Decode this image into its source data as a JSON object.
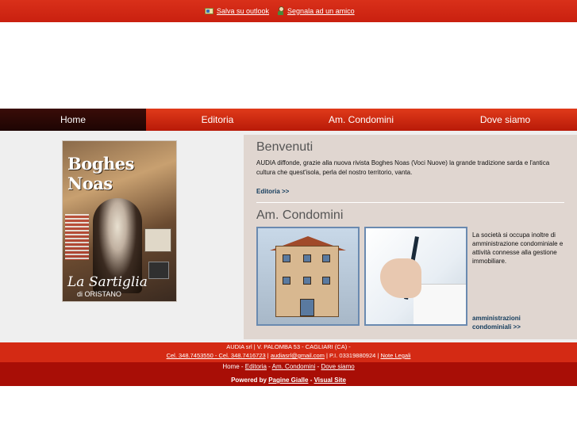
{
  "topbar": {
    "outlook_label": "Salva su outlook",
    "outlook_icon": "outlook-icon",
    "friend_label": "Segnala ad un amico",
    "friend_icon": "person-icon"
  },
  "nav": {
    "items": [
      "Home",
      "Editoria",
      "Am. Condomini",
      "Dove siamo"
    ],
    "active": "Home"
  },
  "cover": {
    "title": "Boghes Noas",
    "script_text": "La Sartiglia",
    "sub_text": "di ORISTANO"
  },
  "benvenuti": {
    "title": "Benvenuti",
    "text": "AUDIA diffonde, grazie alla nuova rivista Boghes Noas (Voci Nuove) la grande tradizione sarda e l'antica cultura che quest'isola, perla del nostro territorio, vanta.",
    "link": "Editoria >>"
  },
  "condomini": {
    "title": "Am. Condomini",
    "text": "La società si occupa inoltre di amministrazione condominiale e attività connesse alla gestione immobiliare.",
    "link": "amministrazioni condominiali >>"
  },
  "footer": {
    "address": "AUDIA srl | V. PALOMBA 53 - CAGLIARI (CA) -",
    "phones": "Cel. 348.7453550 - Cel. 348.7416723",
    "email": "audiasrl@gmail.com",
    "piva": "P.I. 03319880924",
    "legal": "Note Legali",
    "sep": "|",
    "nav": [
      "Home",
      "Editoria",
      "Am. Condomini",
      "Dove siamo"
    ],
    "nav_sep": "-",
    "powered_prefix": "Powered by",
    "powered_links": [
      "Pagine Gialle",
      "Visual Site"
    ]
  },
  "colors": {
    "brand_red": "#d42a14",
    "dark_red": "#a80e06",
    "nav_active": "#2a0805",
    "panel_bg": "#e0d6d0",
    "link_blue": "#123b5c"
  }
}
